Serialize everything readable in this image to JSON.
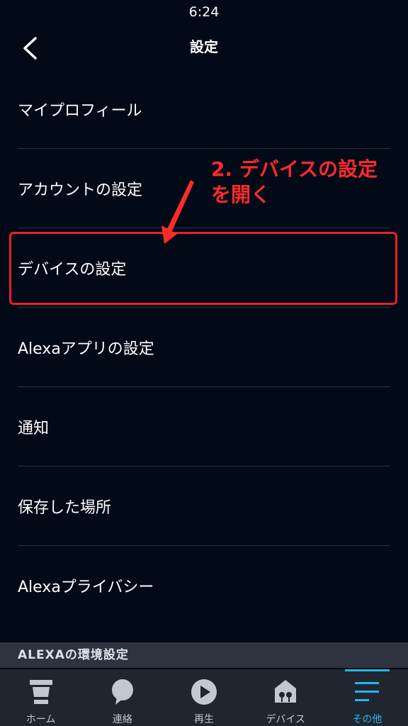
{
  "status_bar": {
    "time": "6:24"
  },
  "header": {
    "title": "設定"
  },
  "menu": {
    "items": [
      {
        "label": "マイプロフィール"
      },
      {
        "label": "アカウントの設定"
      },
      {
        "label": "デバイスの設定"
      },
      {
        "label": "Alexaアプリの設定"
      },
      {
        "label": "通知"
      },
      {
        "label": "保存した場所"
      },
      {
        "label": "Alexaプライバシー"
      }
    ]
  },
  "annotation": {
    "text": "2. デバイスの設定を開く",
    "color": "#ff2a2a"
  },
  "section": {
    "title": "ALEXAの環境設定"
  },
  "tabs": [
    {
      "label": "ホーム",
      "icon": "home-icon",
      "active": false
    },
    {
      "label": "連絡",
      "icon": "chat-bubble-icon",
      "active": false
    },
    {
      "label": "再生",
      "icon": "play-icon",
      "active": false
    },
    {
      "label": "デバイス",
      "icon": "devices-icon",
      "active": false
    },
    {
      "label": "その他",
      "icon": "menu-icon",
      "active": true
    }
  ],
  "colors": {
    "background": "#030a17",
    "accent": "#25b6f0",
    "highlight": "#e5202a",
    "tab_bar": "#1f2630"
  }
}
